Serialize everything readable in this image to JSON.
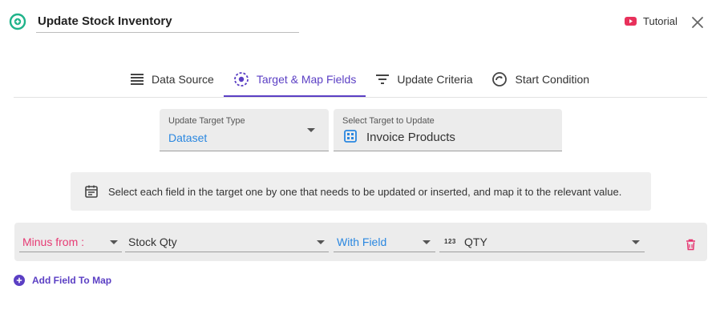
{
  "header": {
    "title": "Update Stock Inventory",
    "tutorial_label": "Tutorial"
  },
  "tabs": [
    {
      "label": "Data Source",
      "icon": "list-icon",
      "active": false
    },
    {
      "label": "Target & Map Fields",
      "icon": "target-icon",
      "active": true
    },
    {
      "label": "Update Criteria",
      "icon": "filter-icon",
      "active": false
    },
    {
      "label": "Start Condition",
      "icon": "gauge-icon",
      "active": false
    }
  ],
  "target": {
    "type_label": "Update Target Type",
    "type_value": "Dataset",
    "select_label": "Select Target to Update",
    "select_value": "Invoice Products"
  },
  "info": {
    "text": "Select each field in the target one by one that needs to be updated or inserted, and map it to the relevant value."
  },
  "mapping": {
    "operation": "Minus from :",
    "target_field": "Stock Qty",
    "source_type": "With Field",
    "source_field_type_badge": "123",
    "source_field": "QTY"
  },
  "add_field_label": "Add Field To Map",
  "colors": {
    "accent": "#5b3fc4",
    "brand_green": "#1fb38a",
    "link_blue": "#2a87e0",
    "operation_pink": "#e63b74",
    "delete_pink": "#e6336f",
    "youtube_red": "#e8315b"
  }
}
